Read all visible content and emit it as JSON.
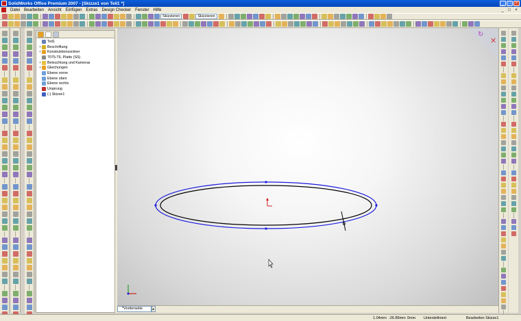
{
  "window": {
    "title": "SolidWorks Office Premium 2007 - [Skizze1 von Teil1 *]"
  },
  "menu": {
    "items": [
      "Datei",
      "Bearbeiten",
      "Ansicht",
      "Einfügen",
      "Extras",
      "Design Checker",
      "Fenster",
      "Hilfe"
    ],
    "mdi_buttons": [
      "_",
      "□",
      "×"
    ]
  },
  "window_buttons": [
    "_",
    "□",
    "×"
  ],
  "toolbar": {
    "dropdowns": [
      "Skizzieren",
      "Skizzieren"
    ]
  },
  "feature_manager": {
    "items": [
      {
        "label": "Teil1",
        "icon": "part-icon",
        "color": "#6b7fb5",
        "expander": ""
      },
      {
        "label": "Beschriftung",
        "icon": "annotations-icon",
        "color": "#d4b020",
        "expander": "+"
      },
      {
        "label": "Konstruktionsordner",
        "icon": "design-folder-icon",
        "color": "#e8a020",
        "expander": "+"
      },
      {
        "label": "7075-T6, Platte (SS)",
        "icon": "material-icon",
        "color": "#8a8a8a",
        "expander": ""
      },
      {
        "label": "Beleuchtung und Kameras",
        "icon": "lights-icon",
        "color": "#e8c040",
        "expander": "+"
      },
      {
        "label": "Gleichungen",
        "icon": "equations-icon",
        "color": "#e8a020",
        "expander": "+"
      },
      {
        "label": "Ebene vorne",
        "icon": "plane-icon",
        "color": "#6fa0d8",
        "expander": ""
      },
      {
        "label": "Ebene oben",
        "icon": "plane-icon",
        "color": "#6fa0d8",
        "expander": ""
      },
      {
        "label": "Ebene rechts",
        "icon": "plane-icon",
        "color": "#6fa0d8",
        "expander": ""
      },
      {
        "label": "Ursprung",
        "icon": "origin-icon",
        "color": "#c03030",
        "expander": ""
      },
      {
        "label": "(-) Skizze1",
        "icon": "sketch-icon",
        "color": "#4060c0",
        "expander": ""
      }
    ]
  },
  "viewport": {
    "tab_label": "*Vorderseite"
  },
  "status": {
    "x": "1.04mm",
    "y": "-26.89mm",
    "z": "0mm",
    "state": "Unterdefiniert",
    "mode": "Bearbeiten Skizze1"
  },
  "colors": {
    "sketch_blue": "#1a1adc",
    "sketch_black": "#000000",
    "origin_red": "#d02020"
  }
}
